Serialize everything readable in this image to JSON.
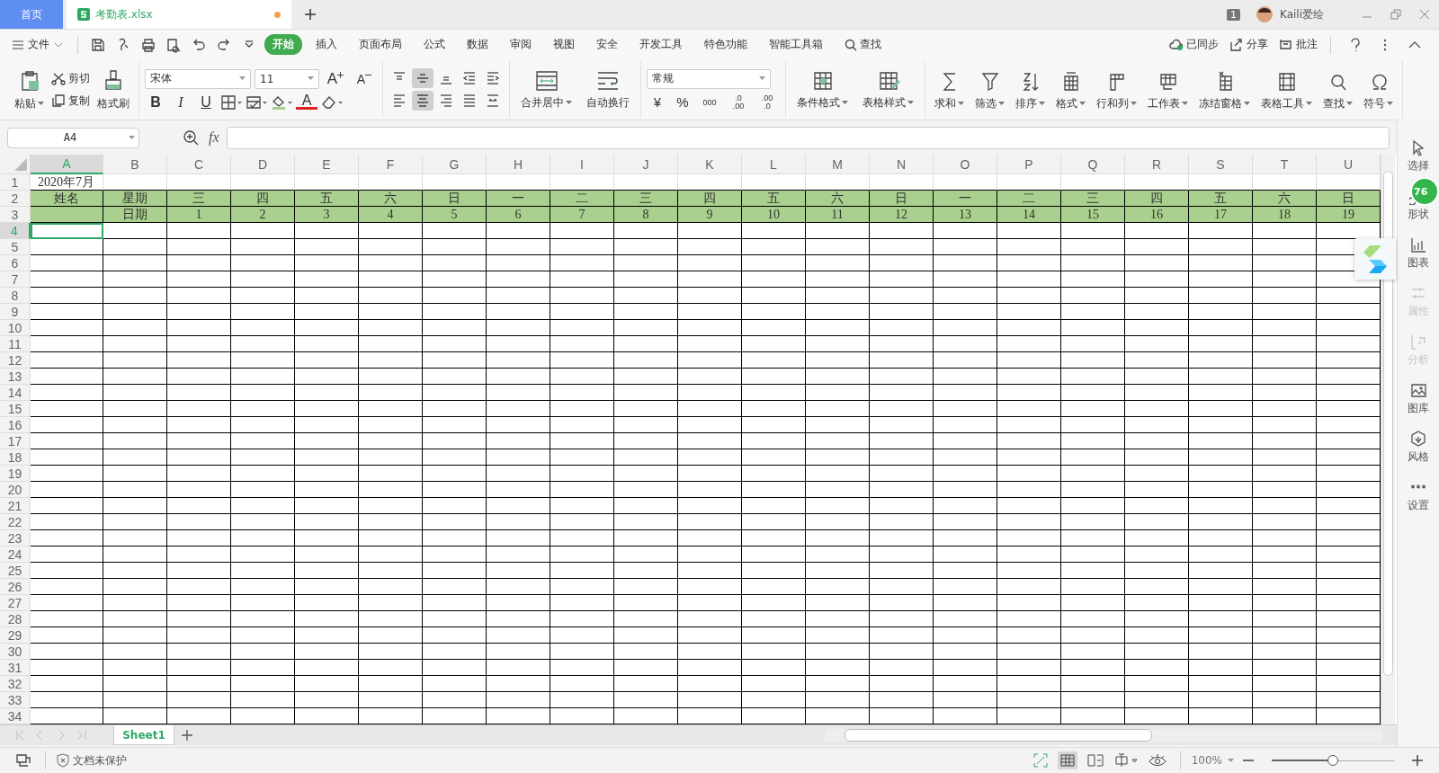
{
  "tabs": [
    {
      "label": "首页",
      "kind": "home",
      "selected": false
    },
    {
      "label": "考勤表.xlsx",
      "kind": "file",
      "selected": true,
      "modified": true
    }
  ],
  "account": {
    "badge": "1",
    "user": "Kaili爱绘"
  },
  "menu": {
    "file": "文件",
    "tabs": [
      {
        "label": "开始",
        "selected": true
      },
      {
        "label": "插入",
        "selected": false
      },
      {
        "label": "页面布局",
        "selected": false
      },
      {
        "label": "公式",
        "selected": false
      },
      {
        "label": "数据",
        "selected": false
      },
      {
        "label": "审阅",
        "selected": false
      },
      {
        "label": "视图",
        "selected": false
      },
      {
        "label": "安全",
        "selected": false
      },
      {
        "label": "开发工具",
        "selected": false
      },
      {
        "label": "特色功能",
        "selected": false
      },
      {
        "label": "智能工具箱",
        "selected": false
      }
    ],
    "search": "查找",
    "actions": [
      "已同步",
      "分享",
      "批注"
    ]
  },
  "ribbon": {
    "clipboard": {
      "paste": "粘贴",
      "cut": "剪切",
      "copy": "复制",
      "painter": "格式刷"
    },
    "font": {
      "name": "宋体",
      "size": "11",
      "grow": "A",
      "shrink": "A",
      "styles": [
        "B",
        "I",
        "U"
      ],
      "color_letter": "A"
    },
    "align": [
      {
        "selected": false
      },
      {
        "selected": true
      },
      {
        "selected": false
      },
      {
        "selected": false
      },
      {
        "selected": false
      },
      {
        "selected": false
      },
      {
        "selected": true
      },
      {
        "selected": false
      },
      {
        "selected": false
      },
      {
        "selected": false
      }
    ],
    "merge": "合并居中",
    "wrap": "自动换行",
    "number": {
      "format": "常规",
      "currency": "¥",
      "percent": "%",
      "thousands": "000",
      "increase_decimal": [
        ".0",
        ".00"
      ],
      "decrease_decimal": [
        ".00",
        ".0"
      ]
    },
    "styles": [
      "条件格式",
      "表格样式"
    ],
    "tools": [
      "求和",
      "筛选",
      "排序",
      "格式",
      "行和列",
      "工作表",
      "冻结窗格",
      "表格工具",
      "查找",
      "符号"
    ]
  },
  "formula_bar": {
    "name_box": "A4",
    "fx": "fx"
  },
  "sheet": {
    "columns": [
      {
        "label": "A",
        "selected": true
      },
      {
        "label": "B",
        "selected": false
      },
      {
        "label": "C",
        "selected": false
      },
      {
        "label": "D",
        "selected": false
      },
      {
        "label": "E",
        "selected": false
      },
      {
        "label": "F",
        "selected": false
      },
      {
        "label": "G",
        "selected": false
      },
      {
        "label": "H",
        "selected": false
      },
      {
        "label": "I",
        "selected": false
      },
      {
        "label": "J",
        "selected": false
      },
      {
        "label": "K",
        "selected": false
      },
      {
        "label": "L",
        "selected": false
      },
      {
        "label": "M",
        "selected": false
      },
      {
        "label": "N",
        "selected": false
      },
      {
        "label": "O",
        "selected": false
      },
      {
        "label": "P",
        "selected": false
      },
      {
        "label": "Q",
        "selected": false
      },
      {
        "label": "R",
        "selected": false
      },
      {
        "label": "S",
        "selected": false
      },
      {
        "label": "T",
        "selected": false
      },
      {
        "label": "U",
        "selected": false
      }
    ],
    "rows": [
      {
        "number": "1",
        "kind": "title",
        "selected": false,
        "cells": [
          {
            "text": "2020年7月"
          }
        ]
      },
      {
        "number": "2",
        "kind": "header",
        "selected": false,
        "cells": [
          {
            "text": "姓名"
          },
          {
            "text": "星期"
          },
          {
            "text": "三"
          },
          {
            "text": "四"
          },
          {
            "text": "五"
          },
          {
            "text": "六"
          },
          {
            "text": "日"
          },
          {
            "text": "一"
          },
          {
            "text": "二"
          },
          {
            "text": "三"
          },
          {
            "text": "四"
          },
          {
            "text": "五"
          },
          {
            "text": "六"
          },
          {
            "text": "日"
          },
          {
            "text": "一"
          },
          {
            "text": "二"
          },
          {
            "text": "三"
          },
          {
            "text": "四"
          },
          {
            "text": "五"
          },
          {
            "text": "六"
          },
          {
            "text": "日"
          }
        ]
      },
      {
        "number": "3",
        "kind": "header",
        "selected": false,
        "cells": [
          {},
          {
            "text": "日期"
          },
          {
            "text": "1"
          },
          {
            "text": "2"
          },
          {
            "text": "3"
          },
          {
            "text": "4"
          },
          {
            "text": "5"
          },
          {
            "text": "6"
          },
          {
            "text": "7"
          },
          {
            "text": "8"
          },
          {
            "text": "9"
          },
          {
            "text": "10"
          },
          {
            "text": "11"
          },
          {
            "text": "12"
          },
          {
            "text": "13"
          },
          {
            "text": "14"
          },
          {
            "text": "15"
          },
          {
            "text": "16"
          },
          {
            "text": "17"
          },
          {
            "text": "18"
          },
          {
            "text": "19"
          }
        ]
      },
      {
        "number": "4",
        "kind": "table",
        "selected": true
      },
      {
        "number": "5",
        "kind": "table",
        "selected": false
      },
      {
        "number": "6",
        "kind": "table",
        "selected": false
      },
      {
        "number": "7",
        "kind": "table",
        "selected": false
      },
      {
        "number": "8",
        "kind": "table",
        "selected": false
      },
      {
        "number": "9",
        "kind": "table",
        "selected": false
      },
      {
        "number": "10",
        "kind": "table",
        "selected": false
      },
      {
        "number": "11",
        "kind": "table",
        "selected": false
      },
      {
        "number": "12",
        "kind": "table",
        "selected": false
      },
      {
        "number": "13",
        "kind": "table",
        "selected": false
      },
      {
        "number": "14",
        "kind": "table",
        "selected": false
      },
      {
        "number": "15",
        "kind": "table",
        "selected": false
      },
      {
        "number": "16",
        "kind": "table",
        "selected": false
      },
      {
        "number": "17",
        "kind": "table",
        "selected": false
      },
      {
        "number": "18",
        "kind": "table",
        "selected": false
      },
      {
        "number": "19",
        "kind": "table",
        "selected": false
      },
      {
        "number": "20",
        "kind": "table",
        "selected": false
      },
      {
        "number": "21",
        "kind": "table",
        "selected": false
      },
      {
        "number": "22",
        "kind": "table",
        "selected": false
      },
      {
        "number": "23",
        "kind": "table",
        "selected": false
      },
      {
        "number": "24",
        "kind": "table",
        "selected": false
      },
      {
        "number": "25",
        "kind": "table",
        "selected": false
      },
      {
        "number": "26",
        "kind": "table",
        "selected": false
      },
      {
        "number": "27",
        "kind": "table",
        "selected": false
      },
      {
        "number": "28",
        "kind": "table",
        "selected": false
      },
      {
        "number": "29",
        "kind": "table",
        "selected": false
      },
      {
        "number": "30",
        "kind": "table",
        "selected": false
      },
      {
        "number": "31",
        "kind": "table",
        "selected": false
      },
      {
        "number": "32",
        "kind": "table",
        "selected": false
      },
      {
        "number": "33",
        "kind": "table",
        "selected": false
      },
      {
        "number": "34",
        "kind": "table",
        "selected": false
      }
    ]
  },
  "sidebar": [
    {
      "label": "选择",
      "disabled": false
    },
    {
      "label": "形状",
      "disabled": false
    },
    {
      "label": "图表",
      "disabled": false
    },
    {
      "label": "属性",
      "disabled": true
    },
    {
      "label": "分析",
      "disabled": true
    },
    {
      "label": "图库",
      "disabled": false
    },
    {
      "label": "风格",
      "disabled": false
    },
    {
      "label": "设置",
      "disabled": false
    }
  ],
  "badge": "76",
  "sheet_tabs": [
    {
      "label": "Sheet1",
      "selected": true
    }
  ],
  "status": {
    "protection": "文档未保护",
    "zoom": "100%",
    "zoom_slider": {
      "level": 0.5
    }
  }
}
